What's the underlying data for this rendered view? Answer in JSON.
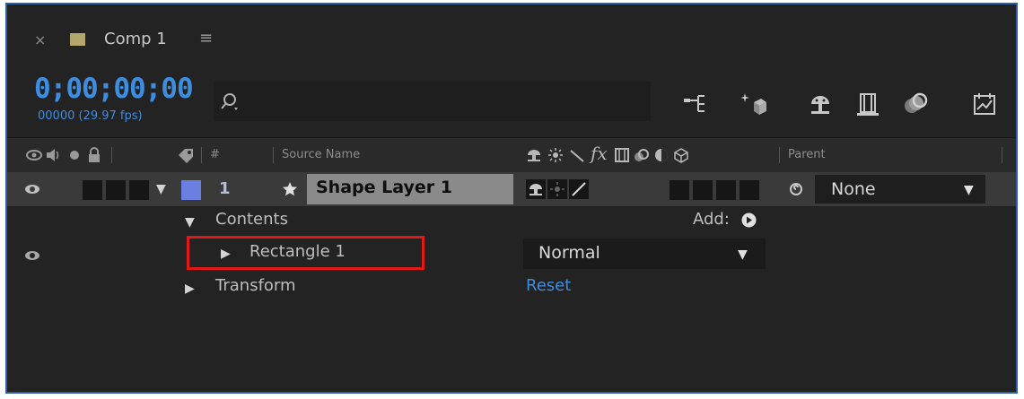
{
  "tab": {
    "close": "×",
    "title": "Comp 1",
    "menu": "≡",
    "swatch_color": "#b5a66c"
  },
  "time": {
    "timecode": "0;00;00;00",
    "frames": "00000 (29.97 fps)"
  },
  "search": {
    "placeholder": "",
    "icon": "search-icon"
  },
  "toolbar": {
    "icons": [
      "comp-flowchart-icon",
      "draft-3d-icon",
      "shy-layers-icon",
      "frame-blending-icon",
      "motion-blur-icon",
      "graph-editor-icon"
    ]
  },
  "columns": {
    "number": "#",
    "source_name": "Source Name",
    "parent": "Parent"
  },
  "layer": {
    "number": "1",
    "name": "Shape Layer 1",
    "label_color": "#6b7fe0",
    "parent_value": "None"
  },
  "contents": {
    "label": "Contents",
    "add_label": "Add:",
    "rectangle_label": "Rectangle 1",
    "blend_mode": "Normal",
    "transform_label": "Transform",
    "reset_label": "Reset"
  },
  "colors": {
    "accent": "#3d8de0",
    "highlight": "#e01818",
    "panel_bg": "#232323"
  }
}
